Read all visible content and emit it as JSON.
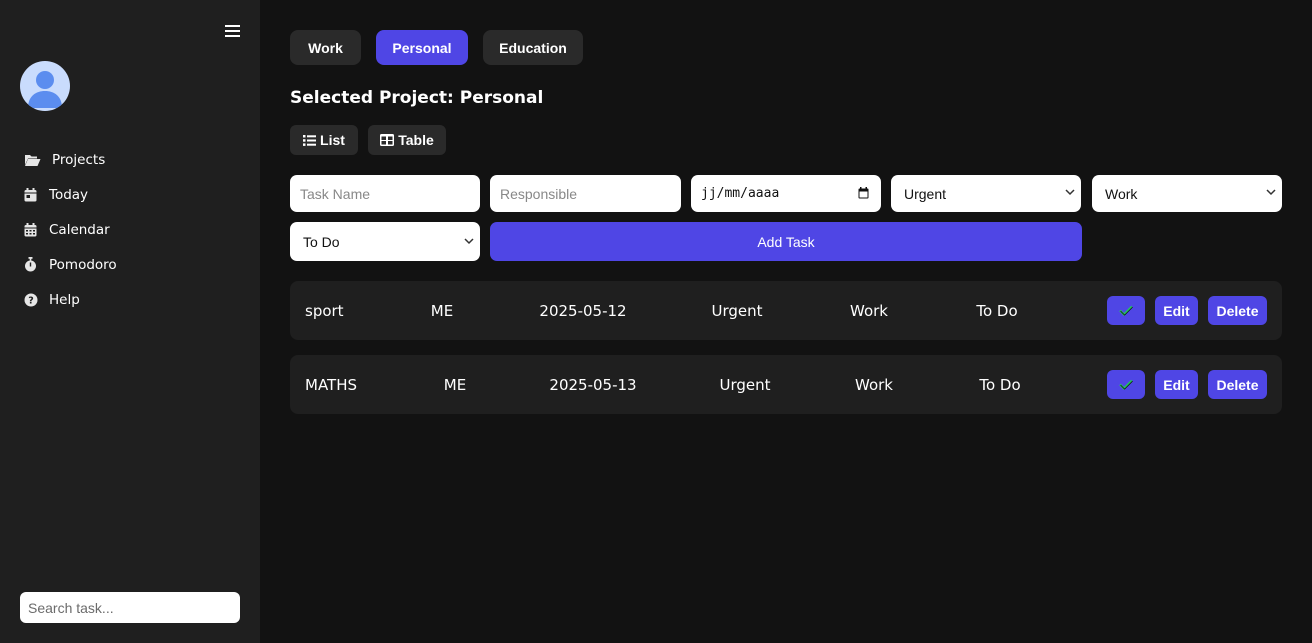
{
  "sidebar": {
    "nav": [
      {
        "label": "Projects",
        "icon": "folder-open-icon"
      },
      {
        "label": "Today",
        "icon": "calendar-day-icon"
      },
      {
        "label": "Calendar",
        "icon": "calendar-grid-icon"
      },
      {
        "label": "Pomodoro",
        "icon": "stopwatch-icon"
      },
      {
        "label": "Help",
        "icon": "question-circle-icon"
      }
    ],
    "search_placeholder": "Search task..."
  },
  "projects": {
    "tabs": [
      "Work",
      "Personal",
      "Education"
    ],
    "active": "Personal"
  },
  "selected_project_title": "Selected Project: Personal",
  "views": {
    "list_label": "List",
    "table_label": "Table"
  },
  "form": {
    "task_name_placeholder": "Task Name",
    "responsible_placeholder": "Responsible",
    "date_placeholder": "jj/mm/aaaa",
    "priority_value": "Urgent",
    "category_value": "Work",
    "status_value": "To Do",
    "add_label": "Add Task"
  },
  "tasks": [
    {
      "name": "sport",
      "responsible": "ME",
      "date": "2025-05-12",
      "priority": "Urgent",
      "category": "Work",
      "status": "To Do"
    },
    {
      "name": "MATHS",
      "responsible": "ME",
      "date": "2025-05-13",
      "priority": "Urgent",
      "category": "Work",
      "status": "To Do"
    }
  ],
  "actions": {
    "edit_label": "Edit",
    "delete_label": "Delete"
  },
  "colors": {
    "accent": "#4f46e5",
    "sidebar": "#1f1f1f",
    "background": "#121212",
    "card": "#1f1f1f",
    "check": "#22c55e"
  }
}
